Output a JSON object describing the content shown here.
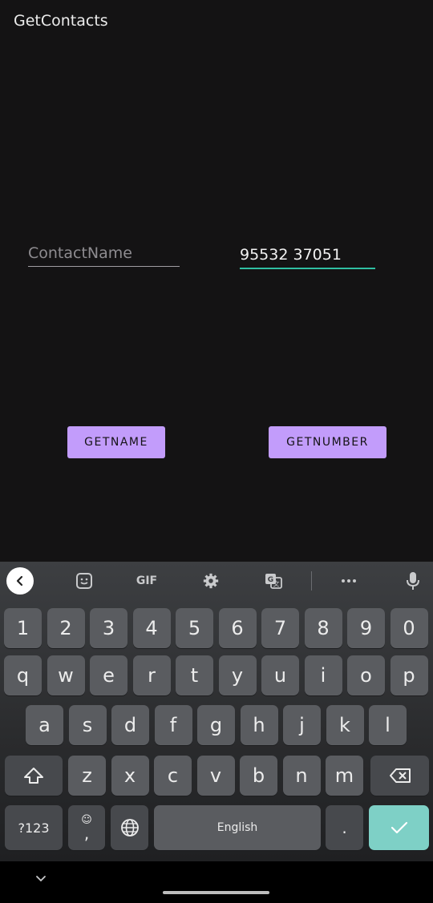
{
  "app": {
    "title": "GetContacts"
  },
  "form": {
    "name_placeholder": "ContactName",
    "name_value": "",
    "number_value": "95532 37051"
  },
  "buttons": {
    "getname": "GETNAME",
    "getnumber": "GETNUMBER"
  },
  "keyboard": {
    "toolbar": {
      "back_icon": "chevron-left-icon",
      "gif_label": "GIF",
      "items": [
        "sticker-icon",
        "gif-label",
        "gear-icon",
        "translate-icon",
        "more-icon",
        "mic-icon"
      ]
    },
    "number_row": [
      "1",
      "2",
      "3",
      "4",
      "5",
      "6",
      "7",
      "8",
      "9",
      "0"
    ],
    "row1": [
      "q",
      "w",
      "e",
      "r",
      "t",
      "y",
      "u",
      "i",
      "o",
      "p"
    ],
    "row2": [
      "a",
      "s",
      "d",
      "f",
      "g",
      "h",
      "j",
      "k",
      "l"
    ],
    "row3": [
      "z",
      "x",
      "c",
      "v",
      "b",
      "n",
      "m"
    ],
    "symbols_label": "?123",
    "emoji_comma_label": ",",
    "space_label": "English",
    "period_label": "."
  },
  "colors": {
    "accent": "#c29cfb",
    "focus": "#2fbfa2",
    "enter": "#7ed0c6"
  }
}
